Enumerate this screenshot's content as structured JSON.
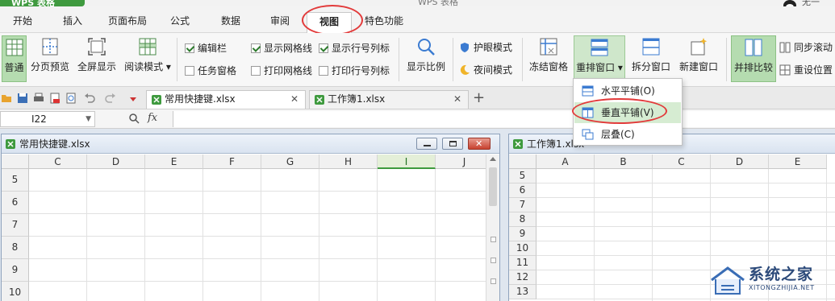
{
  "titlebar": {
    "app_name": "WPS 表格",
    "window_title": "WPS 表格",
    "user": "无一"
  },
  "menu": {
    "tabs": [
      {
        "label": "开始"
      },
      {
        "label": "插入"
      },
      {
        "label": "页面布局"
      },
      {
        "label": "公式"
      },
      {
        "label": "数据"
      },
      {
        "label": "审阅"
      },
      {
        "label": "视图"
      },
      {
        "label": "特色功能"
      }
    ],
    "active_tab": "视图"
  },
  "ribbon": {
    "normal": "普通",
    "page_break_preview": "分页预览",
    "full_screen": "全屏显示",
    "reading_mode": "阅读模式",
    "edit_bar": "编辑栏",
    "task_pane": "任务窗格",
    "show_gridlines": "显示网格线",
    "print_gridlines": "打印网格线",
    "show_row_col_headers": "显示行号列标",
    "print_row_col_headers": "打印行号列标",
    "zoom": "显示比例",
    "eye_protection": "护眼模式",
    "night_mode": "夜间模式",
    "freeze_panes": "冻结窗格",
    "arrange_windows": "重排窗口",
    "split_window": "拆分窗口",
    "new_window": "新建窗口",
    "side_by_side": "并排比较",
    "sync_scroll": "同步滚动",
    "reset_position": "重设位置"
  },
  "checkboxes": {
    "edit_bar": true,
    "task_pane": false,
    "show_gridlines": true,
    "print_gridlines": false,
    "show_row_col_headers": true,
    "print_row_col_headers": false
  },
  "doc_tabs": [
    {
      "name": "常用快捷键.xlsx",
      "active": true
    },
    {
      "name": "工作簿1.xlsx",
      "active": false
    }
  ],
  "formula_bar": {
    "cell_ref": "I22",
    "fx": "fx",
    "value": ""
  },
  "arrange_menu": {
    "items": [
      {
        "label": "水平平铺(O)",
        "highlighted": false
      },
      {
        "label": "垂直平铺(V)",
        "highlighted": true
      },
      {
        "label": "层叠(C)",
        "highlighted": false
      }
    ]
  },
  "window_left": {
    "title": "常用快捷键.xlsx",
    "columns": [
      "C",
      "D",
      "E",
      "F",
      "G",
      "H",
      "I",
      "J"
    ],
    "selected_column": "I",
    "rows": [
      "5",
      "6",
      "7",
      "8",
      "9",
      "10"
    ]
  },
  "window_right": {
    "title": "工作簿1.xlsx",
    "columns": [
      "A",
      "B",
      "C",
      "D",
      "E"
    ],
    "rows": [
      "5",
      "6",
      "7",
      "8",
      "9",
      "10",
      "11",
      "12",
      "13"
    ]
  },
  "watermark": {
    "text": "系统之家",
    "sub": "XITONGZHIJIA.NET"
  },
  "colors": {
    "accent_green": "#3e9a3e",
    "highlight_ring": "#e23a3a",
    "menu_hover": "#d6ecd2"
  }
}
